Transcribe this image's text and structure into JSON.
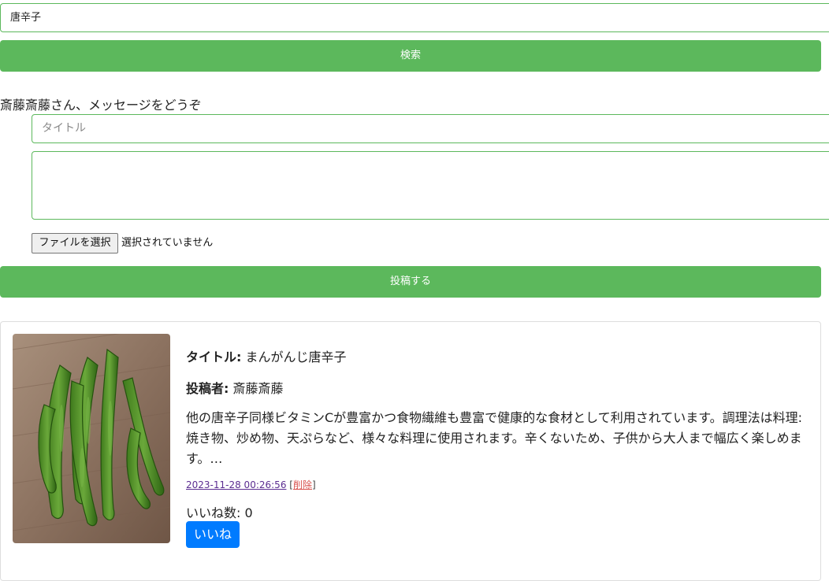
{
  "search": {
    "value": "唐辛子",
    "button_label": "検索"
  },
  "post_form": {
    "greeting": "斎藤斎藤さん、メッセージをどうぞ",
    "title_placeholder": "タイトル",
    "message_value": "",
    "file_button_label": "ファイルを選択",
    "file_status": "選択されていません",
    "submit_label": "投稿する"
  },
  "posts": [
    {
      "title_label": "タイトル:",
      "title": "まんがんじ唐辛子",
      "author_label": "投稿者:",
      "author": "斎藤斎藤",
      "body": "他の唐辛子同様ビタミンCが豊富かつ食物繊維も豊富で健康的な食材として利用されています。調理法は料理: 焼き物、炒め物、天ぷらなど、様々な料理に使用されます。辛くないため、子供から大人まで幅広く楽しめます。…",
      "timestamp": "2023-11-28 00:26:56",
      "delete_open": "[",
      "delete_label": "削除",
      "delete_close": "]",
      "likes_label": "いいね数:",
      "likes_count": "0",
      "like_button_label": "いいね",
      "image_subject": "green-peppers-photo"
    }
  ],
  "colors": {
    "green_accent": "#5cb85c",
    "like_blue": "#007bff",
    "link_purple": "#5b2d91",
    "delete_red": "#d9534f"
  }
}
